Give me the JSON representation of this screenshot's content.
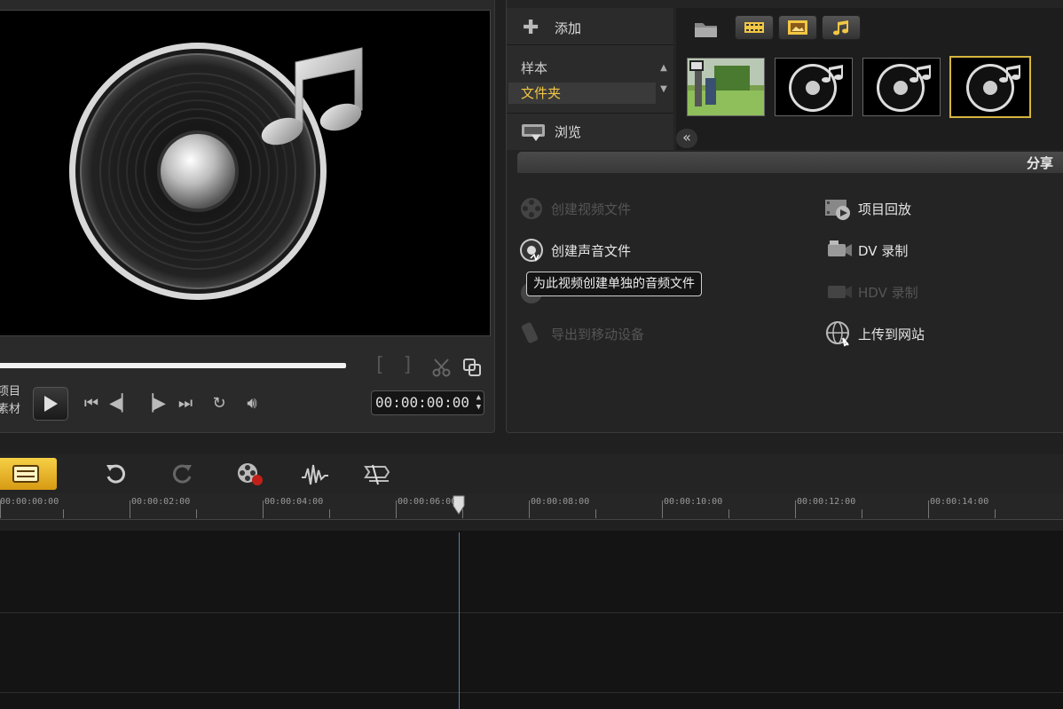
{
  "preview": {
    "mode_project": "项目",
    "mode_clip": "素材",
    "timecode": "00:00:00:00",
    "mark_in": "[",
    "mark_out": "]"
  },
  "library": {
    "add_label": "添加",
    "folders": [
      "样本",
      "文件夹"
    ],
    "selected_folder": "文件夹",
    "browse_label": "浏览",
    "tabs": [
      "video-filter-icon",
      "photo-filter-icon",
      "music-filter-icon"
    ],
    "thumbnails": [
      "video-clip-thumbnail",
      "audio-clip-thumbnail",
      "audio-clip-thumbnail",
      "audio-clip-thumbnail"
    ]
  },
  "share": {
    "title": "分享",
    "items_left": [
      {
        "label": "创建视频文件",
        "enabled": false
      },
      {
        "label": "创建声音文件",
        "enabled": true
      },
      {
        "label": "导出到移动设备",
        "enabled": false
      }
    ],
    "items_right": [
      {
        "label": "项目回放",
        "enabled": true
      },
      {
        "label": "DV 录制",
        "enabled": true
      },
      {
        "label": "HDV 录制",
        "enabled": false
      },
      {
        "label": "上传到网站",
        "enabled": true
      }
    ],
    "tooltip": "为此视频创建单独的音频文件"
  },
  "timeline": {
    "ticks": [
      "00:00:00:00",
      "00:00:02:00",
      "00:00:04:00",
      "00:00:06:00",
      "00:00:08:00",
      "00:00:10:00",
      "00:00:12:00",
      "00:00:14:00"
    ]
  },
  "colors": {
    "accent": "#f2c744",
    "playhead": "#5a7fb0",
    "selected_border": "#d6b53e"
  }
}
